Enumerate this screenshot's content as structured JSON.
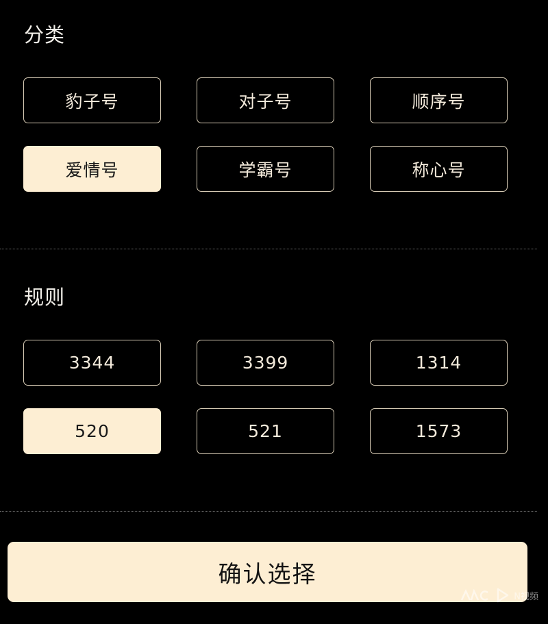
{
  "category": {
    "title": "分类",
    "options": [
      {
        "label": "豹子号"
      },
      {
        "label": "对子号"
      },
      {
        "label": "顺序号"
      },
      {
        "label": "爱情号",
        "selected": true
      },
      {
        "label": "学霸号"
      },
      {
        "label": "称心号"
      }
    ]
  },
  "rules": {
    "title": "规则",
    "options": [
      {
        "label": "3344"
      },
      {
        "label": "3399"
      },
      {
        "label": "1314"
      },
      {
        "label": "520",
        "selected": true
      },
      {
        "label": "521"
      },
      {
        "label": "1573"
      }
    ]
  },
  "confirm_label": "确认选择",
  "watermark": {
    "brand": "N视频"
  },
  "colors": {
    "background": "#000000",
    "accent": "#fdeed3",
    "chip_border": "#d8ccb6"
  }
}
